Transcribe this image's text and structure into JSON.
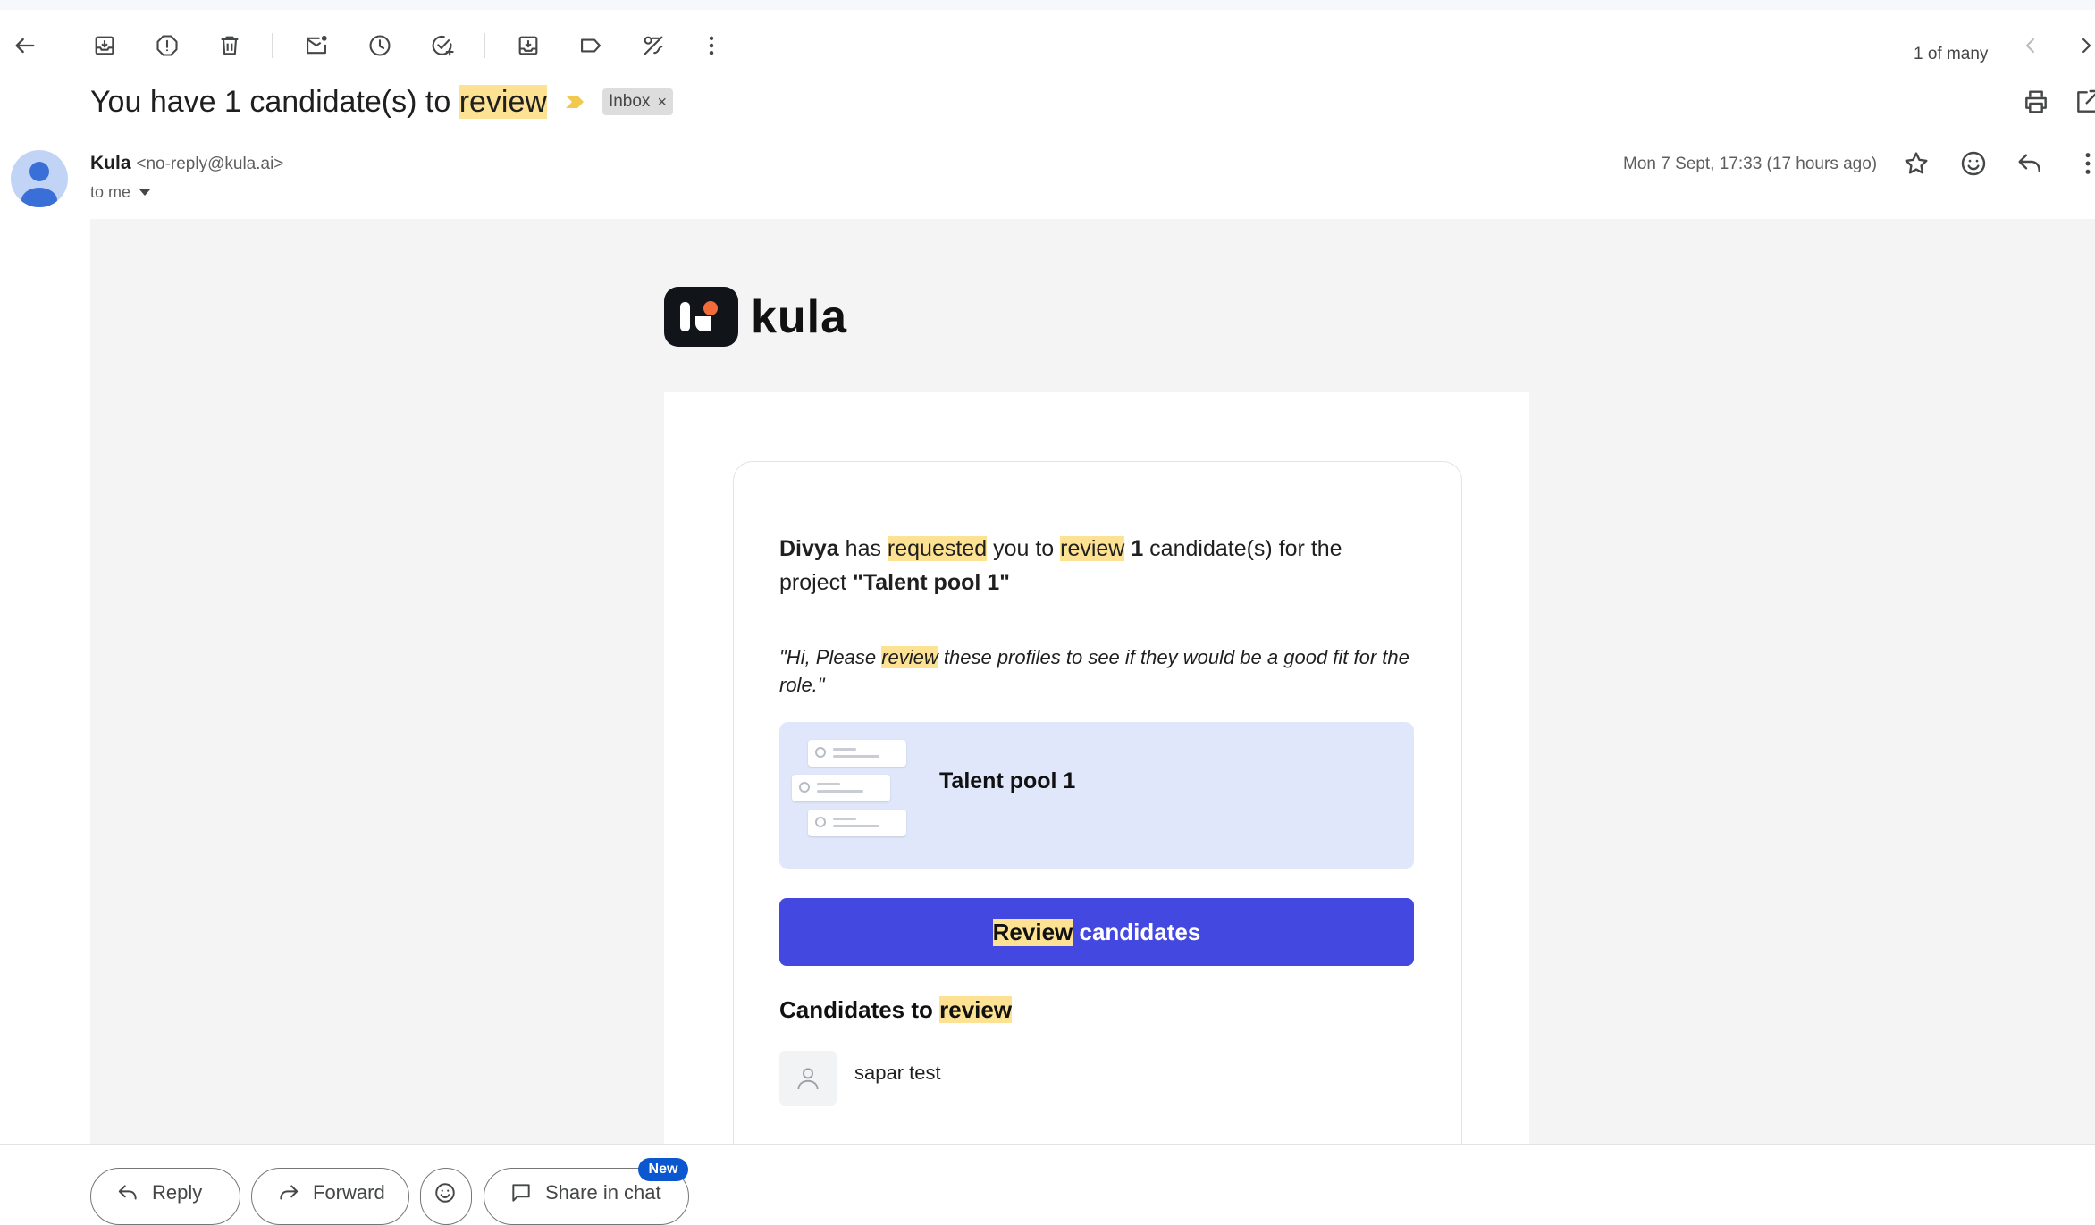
{
  "toolbar": {
    "pager_text": "1 of many"
  },
  "message": {
    "subject_prefix": "You have 1 candidate(s) to ",
    "subject_highlight": "review",
    "label": "Inbox",
    "label_remove": "×"
  },
  "sender": {
    "name": "Kula",
    "email": "<no-reply@kula.ai>",
    "recipient": "to me",
    "date": "Mon 7 Sept, 17:33 (17 hours ago)"
  },
  "body": {
    "logo_text": "kula",
    "intro": {
      "requester": "Divya",
      "t1": " has ",
      "h1": "requested",
      "t2": " you to ",
      "h2": "review",
      "t3": " ",
      "count": "1",
      "t4": " candidate(s) for the project ",
      "project": "\"Talent pool 1\""
    },
    "quote": {
      "q1": "\"Hi, Please ",
      "qh": "review",
      "q2": " these profiles to see if they would be a good fit for the role.\""
    },
    "pool_name": "Talent pool 1",
    "button": {
      "highlight": "Review",
      "rest": " candidates"
    },
    "candidates_title": {
      "t": "Candidates to ",
      "h": "review"
    },
    "candidates": [
      "sapar test"
    ]
  },
  "actions": {
    "reply": "Reply",
    "forward": "Forward",
    "share": "Share in chat",
    "new_badge": "New"
  },
  "colors": {
    "highlight": "#fde293",
    "button": "#4349e0",
    "pool_bg": "#e0e7fb",
    "badge": "#0b57d0"
  }
}
